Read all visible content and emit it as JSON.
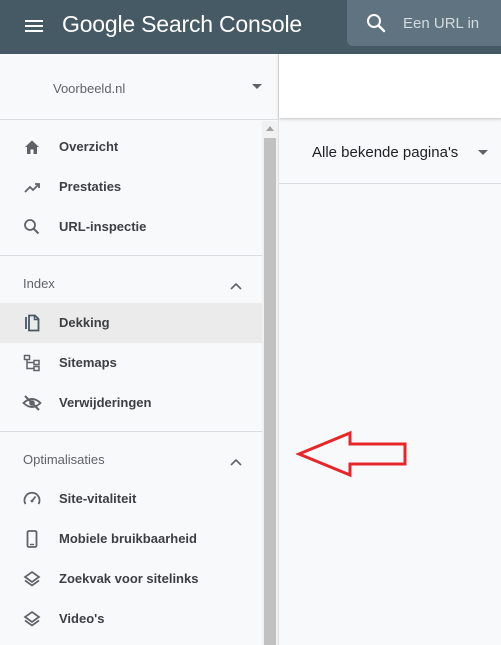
{
  "app": {
    "title": "Google Search Console",
    "menu_icon": "hamburger-menu-icon"
  },
  "search": {
    "placeholder": "Een URL in",
    "icon": "search-icon"
  },
  "property": {
    "name": "Voorbeeld.nl"
  },
  "sidebar": {
    "items": [
      {
        "label": "Overzicht",
        "icon": "home-icon"
      },
      {
        "label": "Prestaties",
        "icon": "trending-up-icon"
      },
      {
        "label": "URL-inspectie",
        "icon": "search-icon"
      }
    ],
    "sections": [
      {
        "label": "Index",
        "expanded": true,
        "items": [
          {
            "label": "Dekking",
            "icon": "copy-pages-icon",
            "active": true
          },
          {
            "label": "Sitemaps",
            "icon": "sitemap-icon"
          },
          {
            "label": "Verwijderingen",
            "icon": "eye-off-icon"
          }
        ]
      },
      {
        "label": "Optimalisaties",
        "expanded": true,
        "items": [
          {
            "label": "Site-vitaliteit",
            "icon": "speedometer-icon"
          },
          {
            "label": "Mobiele bruikbaarheid",
            "icon": "smartphone-icon"
          },
          {
            "label": "Zoekvak voor sitelinks",
            "icon": "layers-icon"
          },
          {
            "label": "Video's",
            "icon": "layers-icon"
          }
        ]
      }
    ]
  },
  "main": {
    "filter_label": "Alle bekende pagina's"
  },
  "colors": {
    "topbar": "#455a64",
    "search_box": "#5f7480",
    "active_item": "#ebebeb",
    "annotation": "#e8262a"
  }
}
